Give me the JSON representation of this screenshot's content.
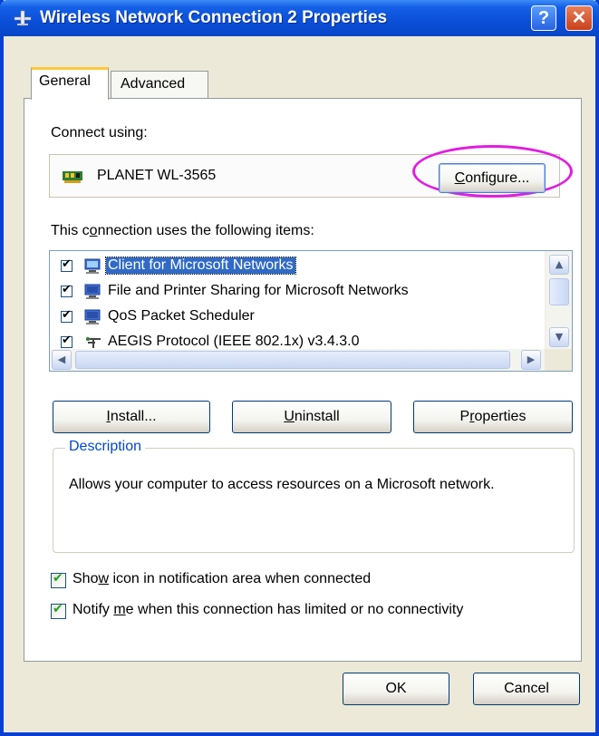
{
  "window": {
    "title": "Wireless Network Connection 2 Properties",
    "help_button": "?",
    "close_button": "✕"
  },
  "tabs": [
    {
      "label": "General",
      "active": true
    },
    {
      "label": "Advanced",
      "active": false
    }
  ],
  "connect_using": {
    "label": "Connect using:",
    "adapter_name": "PLANET WL-3565",
    "configure_prefix": "C",
    "configure_rest": "onfigure..."
  },
  "items_section": {
    "label_pre": "This c",
    "label_mnemonic": "o",
    "label_post": "nnection uses the following items:",
    "items": [
      {
        "label": "Client for Microsoft Networks",
        "checked": true,
        "selected": true,
        "icon": "network-client-icon"
      },
      {
        "label": "File and Printer Sharing for Microsoft Networks",
        "checked": true,
        "selected": false,
        "icon": "network-service-icon"
      },
      {
        "label": "QoS Packet Scheduler",
        "checked": true,
        "selected": false,
        "icon": "network-service-icon"
      },
      {
        "label": "AEGIS Protocol (IEEE 802.1x) v3.4.3.0",
        "checked": true,
        "selected": false,
        "icon": "protocol-icon"
      }
    ]
  },
  "buttons": {
    "install_mnemonic": "I",
    "install_rest": "nstall...",
    "uninstall_mnemonic": "U",
    "uninstall_rest": "ninstall",
    "properties_pre": "P",
    "properties_mnemonic": "r",
    "properties_rest": "operties"
  },
  "description": {
    "title": "Description",
    "text": "Allows your computer to access resources on a Microsoft network."
  },
  "options": {
    "show_icon_pre": "Sho",
    "show_icon_mnemonic": "w",
    "show_icon_rest": " icon in notification area when connected",
    "show_icon_checked": true,
    "notify_pre": "Notify ",
    "notify_mnemonic": "m",
    "notify_rest": "e when this connection has limited or no connectivity",
    "notify_checked": true
  },
  "footer": {
    "ok_label": "OK",
    "cancel_label": "Cancel"
  },
  "colors": {
    "title_bar": "#0A4ED8",
    "highlight_ring": "#E21CE0",
    "selection": "#316AC5",
    "group_title": "#0046D5"
  }
}
